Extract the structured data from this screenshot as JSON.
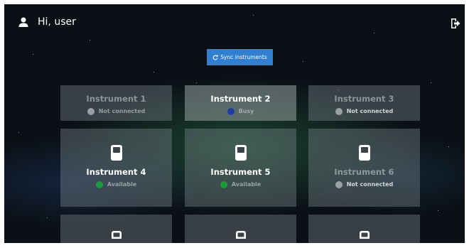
{
  "header": {
    "greeting": "Hi, user",
    "user_icon": "user-icon",
    "logout_icon": "logout-icon"
  },
  "toolbar": {
    "sync_label": "Sync instruments",
    "sync_icon": "sync-icon"
  },
  "colors": {
    "accent": "#2f7fd3",
    "status_not_connected": "#9aa0a4",
    "status_busy": "#1f3fa8",
    "status_available": "#1a9a3a"
  },
  "instruments": [
    {
      "name": "Instrument 1",
      "status": "Not connected"
    },
    {
      "name": "Instrument 2",
      "status": "Busy"
    },
    {
      "name": "Instrument 3",
      "status": "Not connected"
    },
    {
      "name": "Instrument 4",
      "status": "Available"
    },
    {
      "name": "Instrument 5",
      "status": "Available"
    },
    {
      "name": "Instrument 6",
      "status": "Not connected"
    }
  ]
}
